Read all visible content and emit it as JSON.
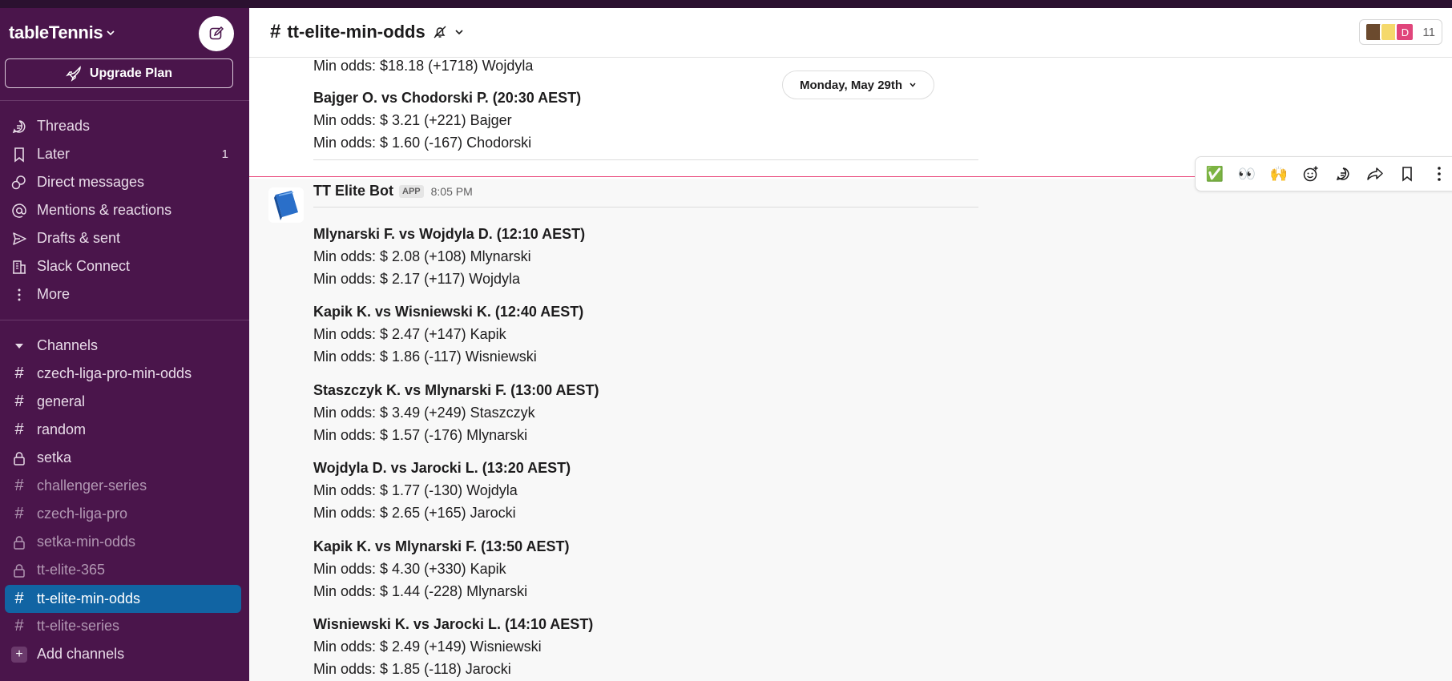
{
  "workspace": {
    "name": "tableTennis"
  },
  "sidebar": {
    "upgrade_label": "Upgrade Plan",
    "nav": [
      {
        "label": "Threads",
        "icon": "threads-icon"
      },
      {
        "label": "Later",
        "icon": "bookmark-icon",
        "count": "1"
      },
      {
        "label": "Direct messages",
        "icon": "direct-messages-icon"
      },
      {
        "label": "Mentions & reactions",
        "icon": "at-icon"
      },
      {
        "label": "Drafts & sent",
        "icon": "send-icon"
      },
      {
        "label": "Slack Connect",
        "icon": "building-icon"
      },
      {
        "label": "More",
        "icon": "more-vertical-icon"
      }
    ],
    "channels_header": "Channels",
    "channels": [
      {
        "name": "czech-liga-pro-min-odds",
        "icon": "hash",
        "muted": false
      },
      {
        "name": "general",
        "icon": "hash",
        "muted": false
      },
      {
        "name": "random",
        "icon": "hash",
        "muted": false
      },
      {
        "name": "setka",
        "icon": "lock",
        "muted": false
      },
      {
        "name": "challenger-series",
        "icon": "hash",
        "muted": true
      },
      {
        "name": "czech-liga-pro",
        "icon": "hash",
        "muted": true
      },
      {
        "name": "setka-min-odds",
        "icon": "lock",
        "muted": true
      },
      {
        "name": "tt-elite-365",
        "icon": "lock",
        "muted": true
      },
      {
        "name": "tt-elite-min-odds",
        "icon": "hash",
        "active": true
      },
      {
        "name": "tt-elite-series",
        "icon": "hash",
        "muted": true
      }
    ],
    "add_channels": "Add channels"
  },
  "channel": {
    "name": "tt-elite-min-odds",
    "member_count": "11",
    "member_avatar_letter": "D"
  },
  "date_divider": "Monday, May 29th",
  "previous_message": {
    "lines": [
      "Min odds: $18.18 (+1718) Wojdyla",
      "Bajger O. vs Chodorski P. (20:30 AEST)",
      "Min odds: $ 3.21 (+221) Bajger",
      "Min odds: $ 1.60 (-167) Chodorski"
    ]
  },
  "message": {
    "sender": "TT Elite Bot",
    "badge": "APP",
    "time": "8:05 PM",
    "matches": [
      {
        "title": "Mlynarski F. vs Wojdyla D. (12:10 AEST)",
        "odds1": "Min odds: $ 2.08 (+108) Mlynarski",
        "odds2": "Min odds: $ 2.17 (+117) Wojdyla"
      },
      {
        "title": "Kapik K. vs Wisniewski K. (12:40 AEST)",
        "odds1": "Min odds: $ 2.47 (+147) Kapik",
        "odds2": "Min odds: $ 1.86 (-117) Wisniewski"
      },
      {
        "title": "Staszczyk K. vs Mlynarski F. (13:00 AEST)",
        "odds1": "Min odds: $ 3.49 (+249) Staszczyk",
        "odds2": "Min odds: $ 1.57 (-176) Mlynarski"
      },
      {
        "title": "Wojdyla D. vs Jarocki L. (13:20 AEST)",
        "odds1": "Min odds: $ 1.77 (-130) Wojdyla",
        "odds2": "Min odds: $ 2.65 (+165) Jarocki"
      },
      {
        "title": "Kapik K. vs Mlynarski F. (13:50 AEST)",
        "odds1": "Min odds: $ 4.30 (+330) Kapik",
        "odds2": "Min odds: $ 1.44 (-228) Mlynarski"
      },
      {
        "title": "Wisniewski K. vs Jarocki L. (14:10 AEST)",
        "odds1": "Min odds: $ 2.49 (+149) Wisniewski",
        "odds2": "Min odds: $ 1.85 (-118) Jarocki"
      }
    ]
  },
  "message_actions": {
    "reactions": [
      "✅",
      "👀",
      "🙌"
    ]
  },
  "colors": {
    "sidebar_bg": "#4a154b",
    "active_channel": "#1164a3",
    "new_message_line": "#e8457a"
  }
}
